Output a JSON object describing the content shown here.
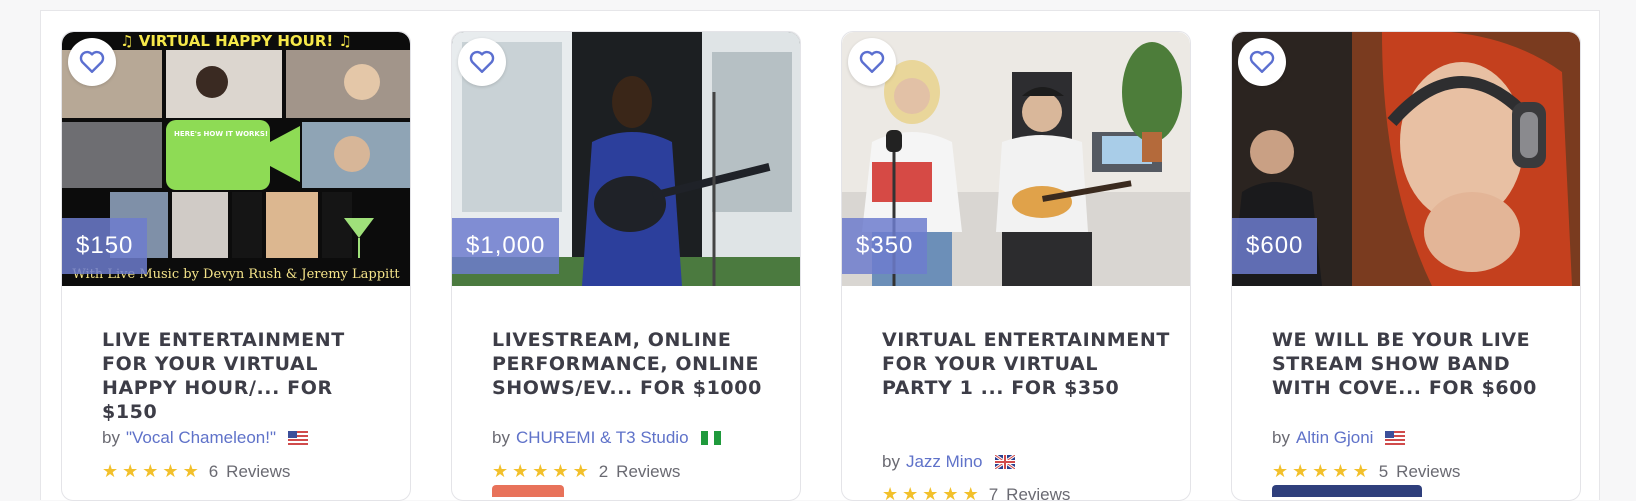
{
  "cards": [
    {
      "price": "$150",
      "title": "Live Entertainment for Your Virtual Happy Hour/... for $150",
      "by": "by",
      "artist": "\"Vocal Chameleon!\"",
      "rating_count": "6",
      "reviews_label": "Reviews",
      "banner_top": "♫ VIRTUAL HAPPY HOUR! ♫",
      "banner_bottom": "With Live Music by Devyn Rush & Jeremy Lappitt",
      "poster_text": "HERE's HOW IT WORKS!",
      "flag": "us-flag-icon"
    },
    {
      "price": "$1,000",
      "title": "Livestream, Online Performance, Online Shows/Ev... for $1000",
      "by": "by",
      "artist": "CHUREMI & T3 Studio",
      "rating_count": "2",
      "reviews_label": "Reviews",
      "flag": "nigeria-flag-icon"
    },
    {
      "price": "$350",
      "title": "Virtual Entertainment for Your Virtual Party 1 ... for $350",
      "by": "by",
      "artist": "Jazz Mino",
      "rating_count": "7",
      "reviews_label": "Reviews",
      "flag": "uk-flag-icon"
    },
    {
      "price": "$600",
      "title": "We Will Be Your Live Stream Show Band with Cove... for $600",
      "by": "by",
      "artist": "Altin Gjoni",
      "rating_count": "5",
      "reviews_label": "Reviews",
      "flag": "us-flag-icon"
    }
  ],
  "colors": {
    "price_badge": "#6d7cce",
    "artist_link": "#5f72c9",
    "star": "#f2c02b",
    "heart": "#5b6fd0"
  }
}
